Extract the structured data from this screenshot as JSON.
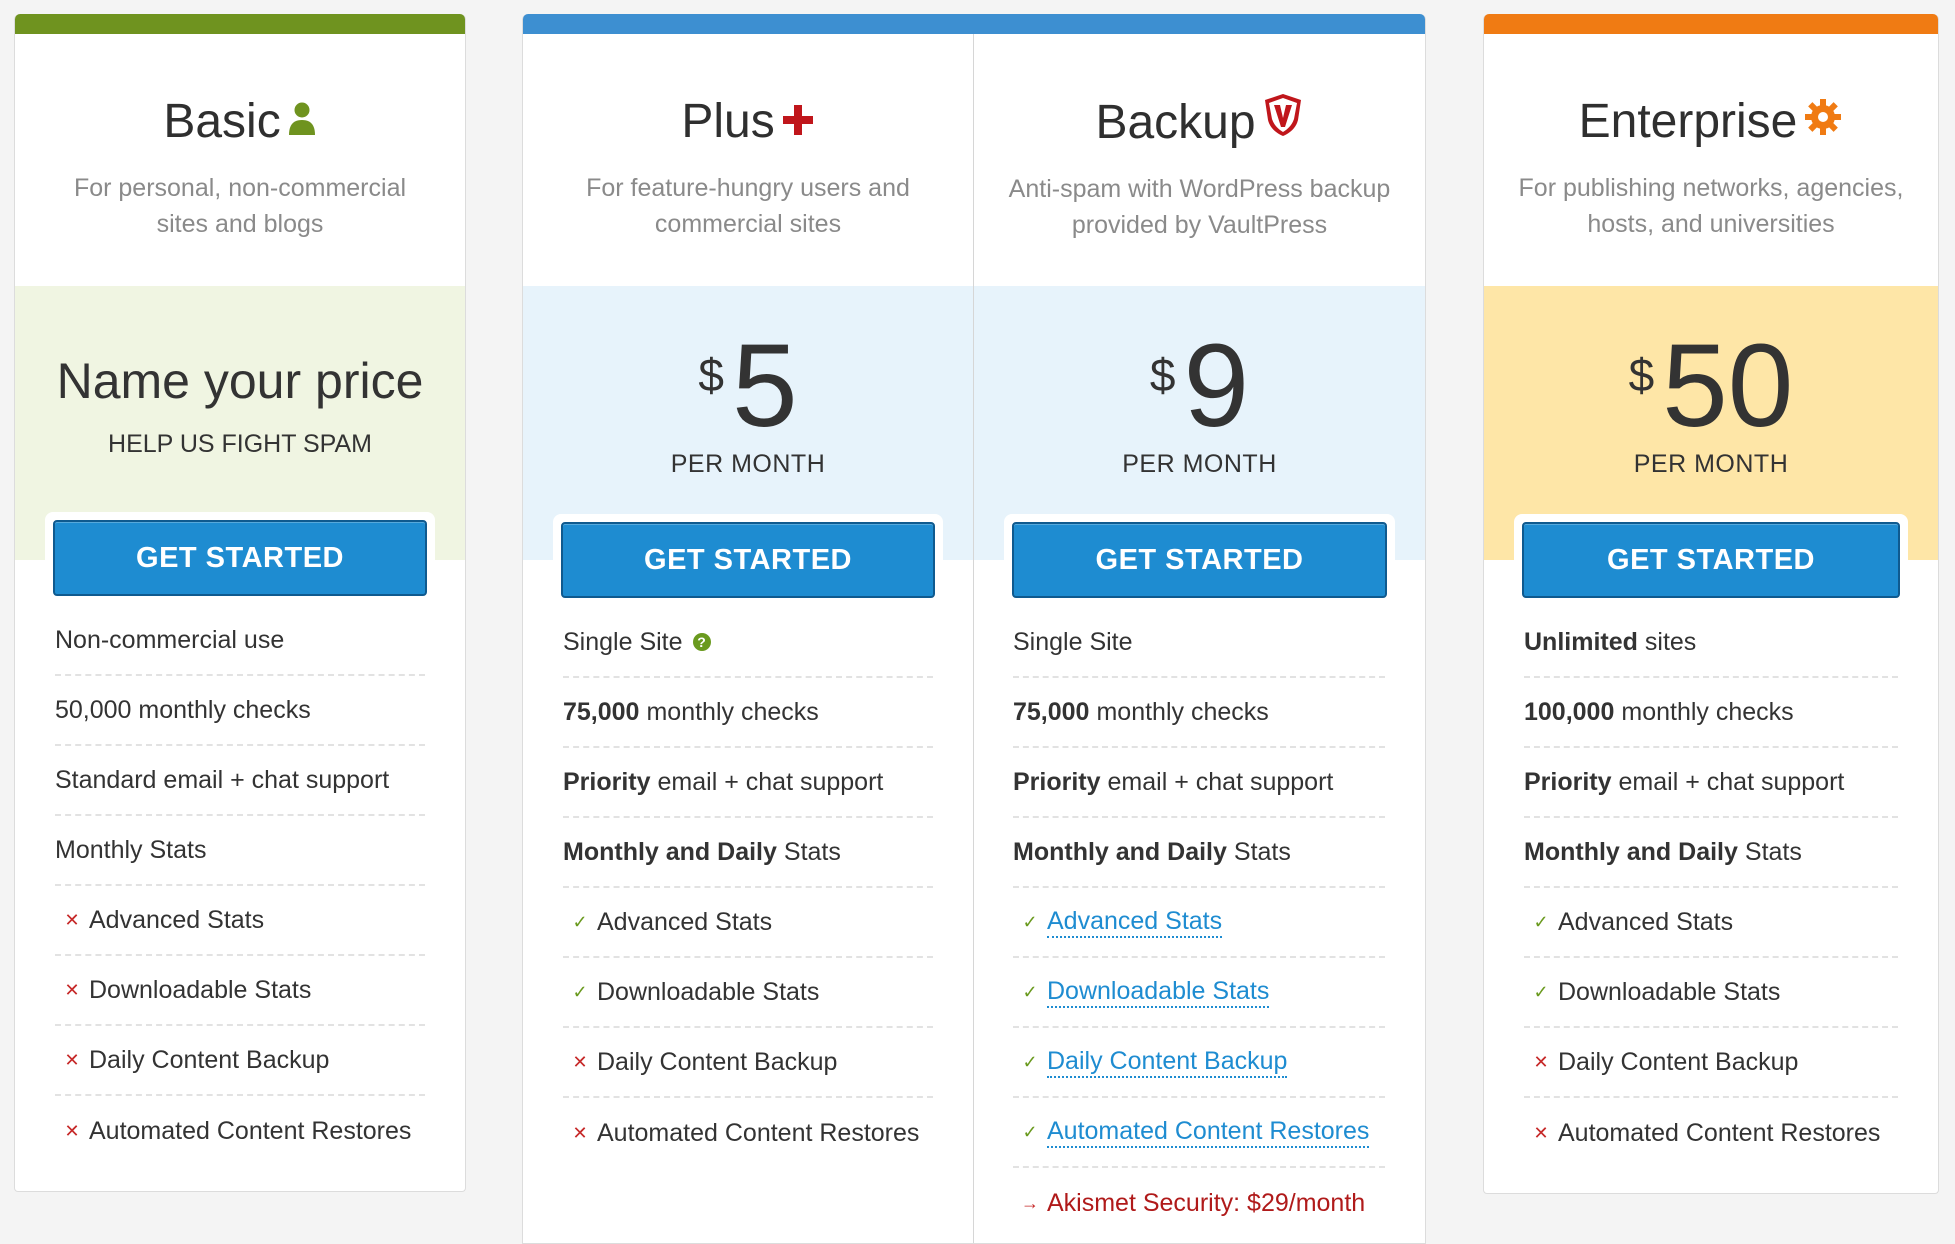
{
  "colors": {
    "basic_bar": "#6f931f",
    "plus_bar": "#3d8fd1",
    "enterprise_bar": "#f07b13",
    "basic_band": "#f0f5e2",
    "plus_band": "#e7f3fb",
    "enterprise_band": "#fee6a7",
    "button": "#1e8cd1"
  },
  "plans": {
    "basic": {
      "name": "Basic",
      "icon": "person-icon",
      "desc": "For personal, non-commercial sites and blogs",
      "price_title": "Name your price",
      "price_sub": "HELP US FIGHT SPAM",
      "cta": "GET STARTED",
      "features": {
        "f1": "Non-commercial use",
        "f2": "50,000 monthly checks",
        "f3": "Standard email + chat support",
        "f4": "Monthly Stats",
        "f5": "Advanced Stats",
        "f6": "Downloadable Stats",
        "f7": "Daily Content Backup",
        "f8": "Automated Content Restores"
      }
    },
    "plus": {
      "name": "Plus",
      "icon": "plus-icon",
      "desc": "For feature-hungry users and commercial sites",
      "currency": "$",
      "amount": "5",
      "per": "PER MONTH",
      "cta": "GET STARTED",
      "features": {
        "f1": "Single Site",
        "f2_bold": "75,000",
        "f2": "monthly checks",
        "f3_bold": "Priority",
        "f3": "email + chat support",
        "f4_bold": "Monthly and Daily",
        "f4": "Stats",
        "f5": "Advanced Stats",
        "f6": "Downloadable Stats",
        "f7": "Daily Content Backup",
        "f8": "Automated Content Restores"
      }
    },
    "backup": {
      "name": "Backup",
      "icon": "vaultpress-shield-icon",
      "desc": "Anti-spam with WordPress backup provided by VaultPress",
      "currency": "$",
      "amount": "9",
      "per": "PER MONTH",
      "cta": "GET STARTED",
      "features": {
        "f1": "Single Site",
        "f2_bold": "75,000",
        "f2": "monthly checks",
        "f3_bold": "Priority",
        "f3": "email + chat support",
        "f4_bold": "Monthly and Daily",
        "f4": "Stats",
        "f5": "Advanced Stats",
        "f6": "Downloadable Stats",
        "f7": "Daily Content Backup",
        "f8": "Automated Content Restores",
        "f9": "Akismet Security: $29/month"
      }
    },
    "enterprise": {
      "name": "Enterprise",
      "icon": "gear-icon",
      "desc": "For publishing networks, agencies, hosts, and universities",
      "currency": "$",
      "amount": "50",
      "per": "PER MONTH",
      "cta": "GET STARTED",
      "features": {
        "f1_bold": "Unlimited",
        "f1": "sites",
        "f2_bold": "100,000",
        "f2": "monthly checks",
        "f3_bold": "Priority",
        "f3": "email + chat support",
        "f4_bold": "Monthly and Daily",
        "f4": "Stats",
        "f5": "Advanced Stats",
        "f6": "Downloadable Stats",
        "f7": "Daily Content Backup",
        "f8": "Automated Content Restores"
      }
    }
  }
}
